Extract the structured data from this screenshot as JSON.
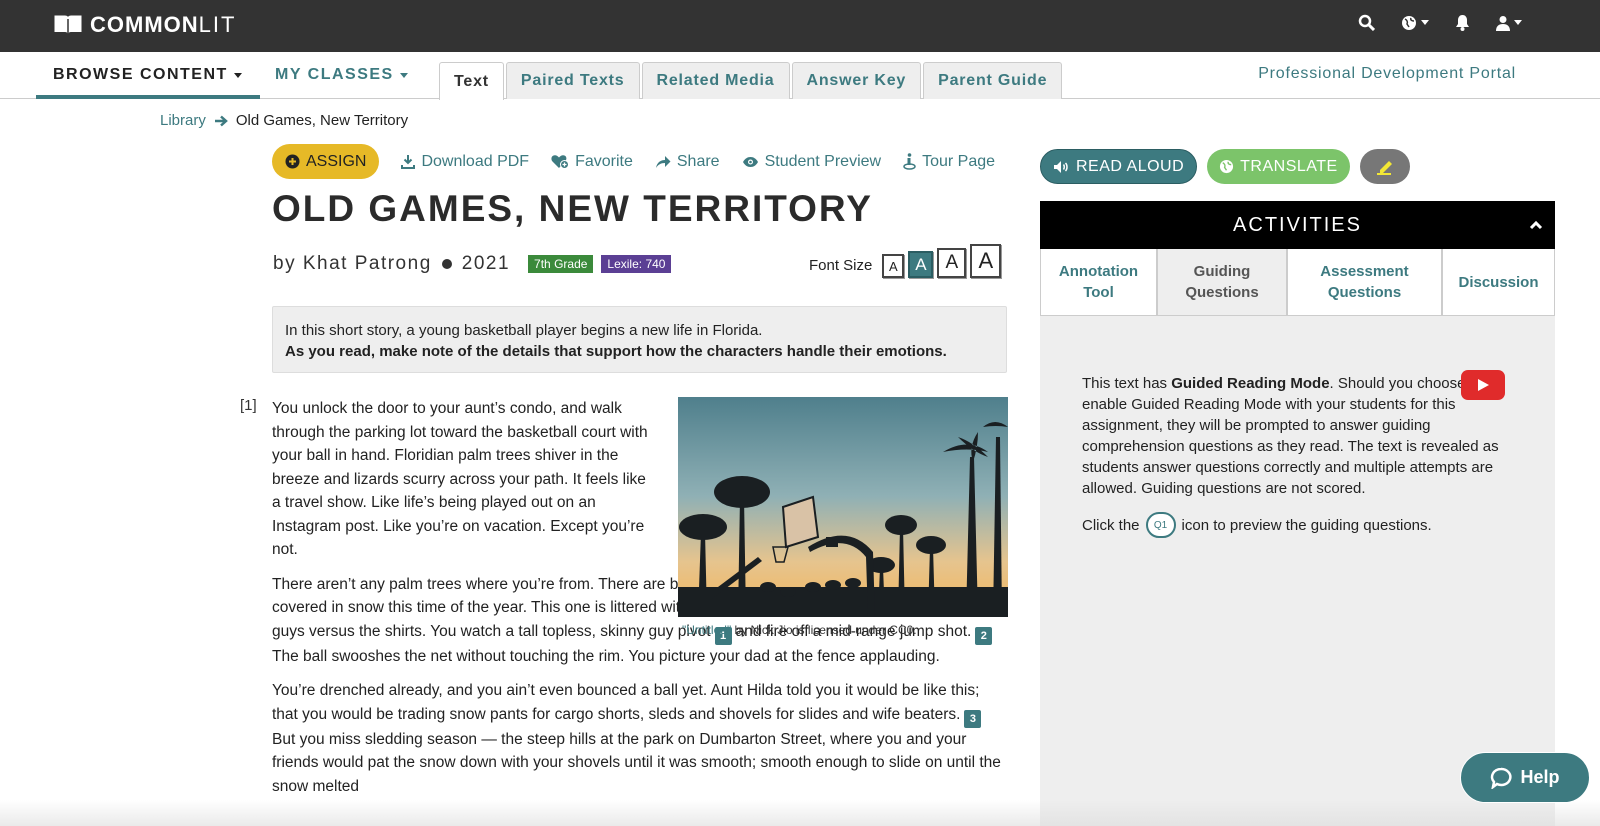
{
  "header": {
    "logo_bold": "COMMON",
    "logo_light": "LIT",
    "icons": [
      "search-icon",
      "globe-icon",
      "bell-icon",
      "user-icon"
    ]
  },
  "nav": {
    "browse_content": "BROWSE CONTENT",
    "my_classes": "MY CLASSES",
    "tabs": [
      {
        "label": "Text",
        "active": true
      },
      {
        "label": "Paired Texts",
        "active": false
      },
      {
        "label": "Related Media",
        "active": false
      },
      {
        "label": "Answer Key",
        "active": false
      },
      {
        "label": "Parent Guide",
        "active": false
      }
    ],
    "portal_link": "Professional Development Portal"
  },
  "breadcrumb": {
    "root": "Library",
    "current": "Old Games, New Territory"
  },
  "actions": {
    "assign": "ASSIGN",
    "download": "Download PDF",
    "favorite": "Favorite",
    "share": "Share",
    "preview": "Student Preview",
    "tour": "Tour Page"
  },
  "text": {
    "title": "OLD GAMES, NEW TERRITORY",
    "author_line": "by Khat Patrong",
    "year": "2021",
    "grade_badge": "7th Grade",
    "lexile_badge": "Lexile: 740",
    "font_size_label": "Font Size",
    "font_size_options": [
      "A",
      "A",
      "A",
      "A"
    ],
    "font_size_selected_index": 1,
    "intro_line1": "In this short story, a young basketball player begins a new life in Florida.",
    "intro_line2": "As you read, make note of the details that support how the characters handle their emotions.",
    "paragraph_number": "[1]",
    "p1": "You unlock the door to your aunt’s condo, and walk through the parking lot toward the basketball court with your ball in hand. Floridian palm trees shiver in the breeze and lizards scurry across your path. It feels like a travel show. Like life’s being played out on an Instagram post. Like you’re on vacation. Except you’re not.",
    "p2_a": "There aren’t any palm trees where you’re from. There are basketball courts, yes, but they’re usually covered in snow this time of the year. This one is littered with people of all different backgrounds. Shirtless guys versus the shirts. You watch a tall topless, skinny guy pivot",
    "gq1": "1",
    "p2_b": "and fire off a mid-range jump shot.",
    "gq2": "2",
    "p2_c": "The ball swooshes the net without touching the rim. You picture your dad at the fence applauding.",
    "p3_a": "You’re drenched already, and you ain’t even bounced a ball yet. Aunt Hilda told you it would be like this; that you would be trading snow pants for cargo shorts, sleds and shovels for slides and wife beaters.",
    "gq3": "3",
    "p3_b": "But you miss sledding season — the steep hills at the park on Dumbarton Street, where you and your friends would pat the snow down with your shovels until it was smooth; smooth enough to slide on until the snow melted",
    "caption_link": "\"Untitled\"",
    "caption_rest": " by Nick Jio is licensed under CC0."
  },
  "sidebar": {
    "read_aloud": "READ ALOUD",
    "translate": "TRANSLATE",
    "activities_title": "ACTIVITIES",
    "tabs": [
      {
        "label": "Annotation Tool",
        "active": false
      },
      {
        "label": "Guiding Questions",
        "active": true
      },
      {
        "label": "Assessment Questions",
        "active": false
      },
      {
        "label": "Discussion",
        "active": false
      }
    ],
    "gq_intro_prefix": "This text has ",
    "gq_intro_bold": "Guided Reading Mode",
    "gq_intro_rest": ". Should you choose to enable Guided Reading Mode with your students for this assignment, they will be prompted to answer guiding comprehension questions as they read. The text is revealed as students answer questions correctly and multiple attempts are allowed. Guiding questions are not scored.",
    "click_prefix": "Click the",
    "q1_label": "Q1",
    "click_suffix": "icon to preview the guiding questions."
  },
  "help": {
    "label": "Help"
  },
  "colors": {
    "teal": "#3d7a80",
    "gold": "#e6b927",
    "green": "#7cc46a",
    "grade": "#3b8a3b",
    "lexile": "#5b3f94",
    "youtube": "#e02b2b"
  }
}
